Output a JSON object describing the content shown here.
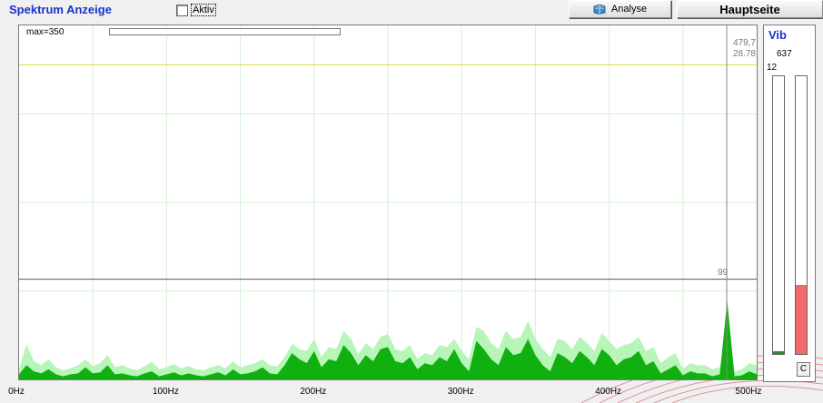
{
  "header": {
    "title": "Spektrum Anzeige",
    "aktiv_label": "Aktiv",
    "aktiv_checked": false,
    "analyse_label": "Analyse",
    "hauptseite_label": "Hauptseite"
  },
  "plot": {
    "max_label": "max=350",
    "cursor_value_1": "479,7",
    "cursor_value_2": "28.78",
    "peak_label": "99"
  },
  "vib": {
    "title": "Vib",
    "value": "637",
    "scale_max": "12",
    "left_level": 0.01,
    "right_level": 0.25,
    "c_button": "C"
  },
  "chart_data": {
    "type": "area",
    "title": "",
    "xlabel": "",
    "ylabel": "",
    "x_tick_labels": [
      "0Hz",
      "100Hz",
      "200Hz",
      "300Hz",
      "400Hz",
      "500Hz"
    ],
    "xlim": [
      0,
      500
    ],
    "ylim": [
      0,
      350
    ],
    "horizontal_lines": [
      {
        "y": 311,
        "color": "#e0e040"
      },
      {
        "y": 99,
        "color": "#555555"
      }
    ],
    "cursor_x": 479.7,
    "series": [
      {
        "x": [
          0,
          5,
          10,
          15,
          20,
          25,
          30,
          35,
          40,
          45,
          50,
          55,
          60,
          65,
          70,
          75,
          80,
          85,
          90,
          95,
          100,
          105,
          110,
          115,
          120,
          125,
          130,
          135,
          140,
          145,
          150,
          155,
          160,
          165,
          170,
          175,
          180,
          185,
          190,
          195,
          200,
          205,
          210,
          215,
          220,
          225,
          230,
          235,
          240,
          245,
          250,
          255,
          260,
          265,
          270,
          275,
          280,
          285,
          290,
          295,
          300,
          305,
          310,
          315,
          320,
          325,
          330,
          335,
          340,
          345,
          350,
          355,
          360,
          365,
          370,
          375,
          380,
          385,
          390,
          395,
          400,
          405,
          410,
          415,
          420,
          425,
          430,
          435,
          440,
          445,
          450,
          455,
          460,
          465,
          470,
          475,
          480,
          485,
          490,
          495,
          500
        ],
        "values": [
          10,
          35,
          18,
          14,
          20,
          12,
          9,
          11,
          14,
          20,
          13,
          16,
          24,
          12,
          14,
          11,
          9,
          13,
          17,
          10,
          12,
          15,
          11,
          13,
          10,
          9,
          12,
          14,
          11,
          18,
          12,
          14,
          16,
          20,
          14,
          13,
          22,
          35,
          30,
          28,
          40,
          22,
          32,
          30,
          48,
          40,
          25,
          36,
          30,
          42,
          45,
          30,
          28,
          34,
          20,
          26,
          24,
          34,
          32,
          40,
          28,
          20,
          52,
          48,
          36,
          30,
          48,
          40,
          42,
          58,
          40,
          30,
          22,
          40,
          38,
          30,
          42,
          36,
          28,
          46,
          38,
          30,
          34,
          36,
          42,
          28,
          32,
          16,
          22,
          26,
          10,
          16,
          14,
          14,
          10,
          12,
          50,
          8,
          10,
          16,
          14
        ]
      },
      {
        "x": [
          0,
          5,
          10,
          15,
          20,
          25,
          30,
          35,
          40,
          45,
          50,
          55,
          60,
          65,
          70,
          75,
          80,
          85,
          90,
          95,
          100,
          105,
          110,
          115,
          120,
          125,
          130,
          135,
          140,
          145,
          150,
          155,
          160,
          165,
          170,
          175,
          180,
          185,
          190,
          195,
          200,
          205,
          210,
          215,
          220,
          225,
          230,
          235,
          240,
          245,
          250,
          255,
          260,
          265,
          270,
          275,
          280,
          285,
          290,
          295,
          300,
          305,
          310,
          315,
          320,
          325,
          330,
          335,
          340,
          345,
          350,
          355,
          360,
          365,
          370,
          375,
          380,
          385,
          390,
          395,
          400,
          405,
          410,
          415,
          420,
          425,
          430,
          435,
          440,
          445,
          450,
          455,
          460,
          465,
          470,
          475,
          480,
          485,
          490,
          495,
          500
        ],
        "values": [
          5,
          14,
          8,
          6,
          10,
          5,
          3,
          5,
          6,
          12,
          6,
          7,
          14,
          5,
          6,
          4,
          3,
          6,
          8,
          3,
          5,
          7,
          4,
          6,
          4,
          3,
          5,
          7,
          4,
          10,
          5,
          6,
          8,
          12,
          6,
          5,
          14,
          26,
          20,
          16,
          28,
          12,
          20,
          18,
          34,
          26,
          14,
          24,
          18,
          30,
          32,
          18,
          16,
          22,
          10,
          16,
          14,
          22,
          18,
          30,
          16,
          8,
          38,
          30,
          20,
          14,
          32,
          24,
          26,
          40,
          24,
          14,
          8,
          26,
          22,
          16,
          28,
          22,
          14,
          30,
          24,
          14,
          20,
          22,
          28,
          14,
          18,
          6,
          10,
          14,
          4,
          8,
          6,
          6,
          3,
          5,
          78,
          3,
          4,
          8,
          5
        ]
      }
    ]
  }
}
